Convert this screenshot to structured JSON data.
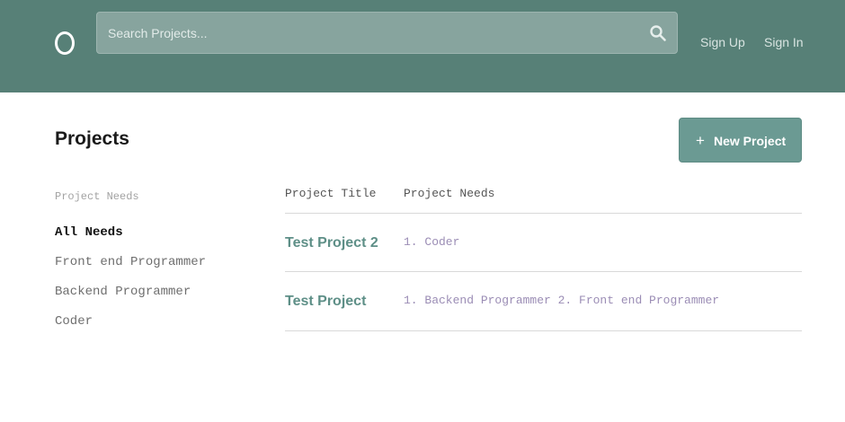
{
  "header": {
    "logo_icon": "circle-logo-icon",
    "search": {
      "placeholder": "Search Projects...",
      "value": "",
      "icon": "search-icon"
    },
    "nav": {
      "sign_up": "Sign Up",
      "sign_in": "Sign In"
    },
    "colors": {
      "background": "#578077",
      "search_bg": "#87a49e"
    }
  },
  "main": {
    "title": "Projects",
    "new_project_button": {
      "icon": "plus-icon",
      "label": "New Project",
      "color": "#6b9a93"
    },
    "filters": {
      "heading": "Project Needs",
      "items": [
        {
          "label": "All Needs",
          "active": true
        },
        {
          "label": "Front end Programmer",
          "active": false
        },
        {
          "label": "Backend Programmer",
          "active": false
        },
        {
          "label": "Coder",
          "active": false
        }
      ]
    },
    "table": {
      "columns": [
        "Project Title",
        "Project Needs"
      ],
      "rows": [
        {
          "title": "Test Project 2",
          "needs": "1. Coder"
        },
        {
          "title": "Test Project",
          "needs": "1. Backend Programmer 2. Front end Programmer"
        }
      ],
      "colors": {
        "title": "#5e8f87",
        "needs": "#9b8db5"
      }
    }
  }
}
